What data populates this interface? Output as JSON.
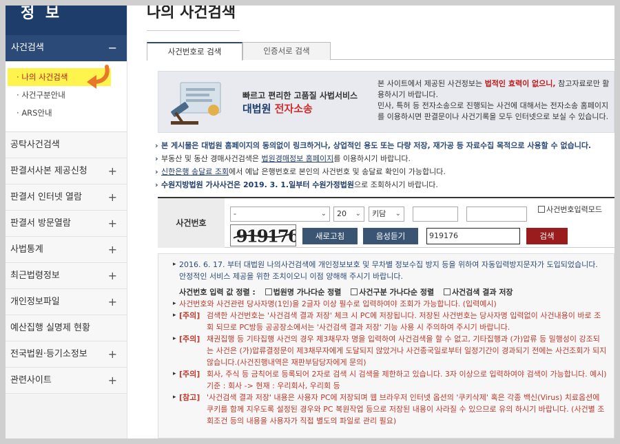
{
  "sidebar": {
    "title": "정 보",
    "active_section": "사건검색",
    "active_toggle": "−",
    "sub_items": [
      "나의 사건검색",
      "사건구분안내",
      "ARS안내"
    ],
    "sub_bullet": "·",
    "items": [
      "공탁사건검색",
      "판결서사본 제공신청",
      "판결서 인터넷 열람",
      "판결서 방문열람",
      "사법통계",
      "최근법령정보",
      "개인정보파일",
      "예산집행 실명제 현황",
      "전국법원·등기소정보",
      "관련사이트"
    ],
    "toggle_plus": "+"
  },
  "main": {
    "title": "나의 사건검색",
    "tabs": [
      "사건번호로 검색",
      "인증서로 검색"
    ],
    "banner": {
      "subtitle": "빠르고 편리한 고품질 사법서비스",
      "title_a": "대법원 ",
      "title_b": "전자소송",
      "text1a": "본 사이트에서 제공된 사건정보는 ",
      "text1b": "법적인 효력이 없으니,",
      "text1c": " 참고자료로만 활용하시기 바랍니다.",
      "text2": "민사, 특허 등 전자소송으로 진행되는 사건에 대해서는 전자소송 홈페이지를 이용하시면 판결문이나 사건기록을 모두 인터넷으로 보실 수 있습니다."
    },
    "notices": {
      "n1": "본 게시물은 대법원 홈페이지의 동의없이 링크하거나, 상업적인 용도 또는 다량 저장, 재가공 등 자료수집 목적으로 사용할 수 없습니다.",
      "n2a": "부동산 및 동산 경매사건검색은 ",
      "n2b": "법원경매정보 홈페이지",
      "n2c": "를 이용하시기 바랍니다.",
      "n3a": "신한은행 송달료 조회",
      "n3b": "에서 예납 은행번호로 본인의 사건번호 및 송달료 확인이 가능합니다.",
      "n4a": "수원지방법원 가사사건은 2019. 3. 1.일부터 수원가정법원",
      "n4b": "으로 조회하시기 바랍니다.",
      "bullet": "›"
    },
    "search": {
      "label": "사건번호",
      "court_select": "-",
      "year_select": "20",
      "type_select": "키담",
      "number_value": "",
      "number2_value": "",
      "mode_checkbox": "사건번호입력모드",
      "captcha_text": "919176",
      "refresh_btn": "새로고침",
      "audio_btn": "음성듣기",
      "captcha_input": "919176",
      "search_btn": "검색"
    },
    "info": {
      "p1": "2016. 6. 17. 부터 대법원 나의사건검색에 개인정보보호 및 무차별 정보수집 방지 등을 위하여 자동입력방지문자가 도입되었습니다. 안정적인 서비스 제공을 위한 조치이오니 이점 양해해 주시기 바랍니다.",
      "order_label": "사건번호 입력 값 정렬 :",
      "order_opts": [
        "법원명 가나다순 정렬",
        "사건구분 가나다순 정렬",
        "사건검색 결과 저장"
      ],
      "p2": "사건번호와 사건관련 당사자명(1인)을 2글자 이상 필수로 입력하여야 조회가 가능합니다. (입력예시)",
      "notes": [
        {
          "tag": "[주의]",
          "text": "검색한 사건번호는 '사건검색 결과 저장' 체크 시 PC에 저장됩니다. 저장된 사건번호는 당사자명 입력없이 사건내용이 바로 조회 되므로 PC방등 공공장소에서는 '사건검색 결과 저장' 기능 사용 시 주의하여 주시기 바랍니다."
        },
        {
          "tag": "[주의]",
          "text": "채권집행 등 기타집행 사건의 경우 제3채무자 명을 입력하여 사건검색을 할 수 없고, 기타집행과 (가)압류 등 밀행성이 강조되는 사건은 (가)압류결정문이 제3채무자에게 도달되지 않았거나 사건종국일로부터 일정기간이 경과되기 전에는 사건조회가 되지 않습니다.(사건진행내역은 재판부담당자에게 문의)"
        },
        {
          "tag": "[주의]",
          "text": "회사, 주식 등 금칙어로 등록되어 2자로 검색 시 검색을 제한하고 있습니다. 3자 이상으로 입력하여야 검색이 가능합니다. 예시) 기준 : 회사 -> 현재 : 우리회사, 우리회 등"
        },
        {
          "tag": "[참고]",
          "text": "'사건검색 결과 저장' 내용은 사용자 PC에 저장되며 웹 브라우저 인터넷 옵션의 '쿠키삭제' 혹은 각종 백신(Virus) 치료옵션에 쿠키를 함께 지우도록 설정된 경우와 PC 복원작업 등으로 저장된 내용이 사라질 수 있으므로 유의 하시기 바랍니다. (사건별 조회조건 등의 내용을 사용자가 직접 별도의 파일로 관리 필요)"
        }
      ]
    }
  },
  "colors": {
    "navy": "#2b4a78",
    "dark_navy": "#1f3d6b",
    "warn_red": "#c21818",
    "highlight": "#fff34d",
    "arrow": "#e8762b"
  },
  "icons": [
    "chevron-down-icon",
    "arrow-pointer-icon",
    "checkbox-icon",
    "court-icon"
  ]
}
